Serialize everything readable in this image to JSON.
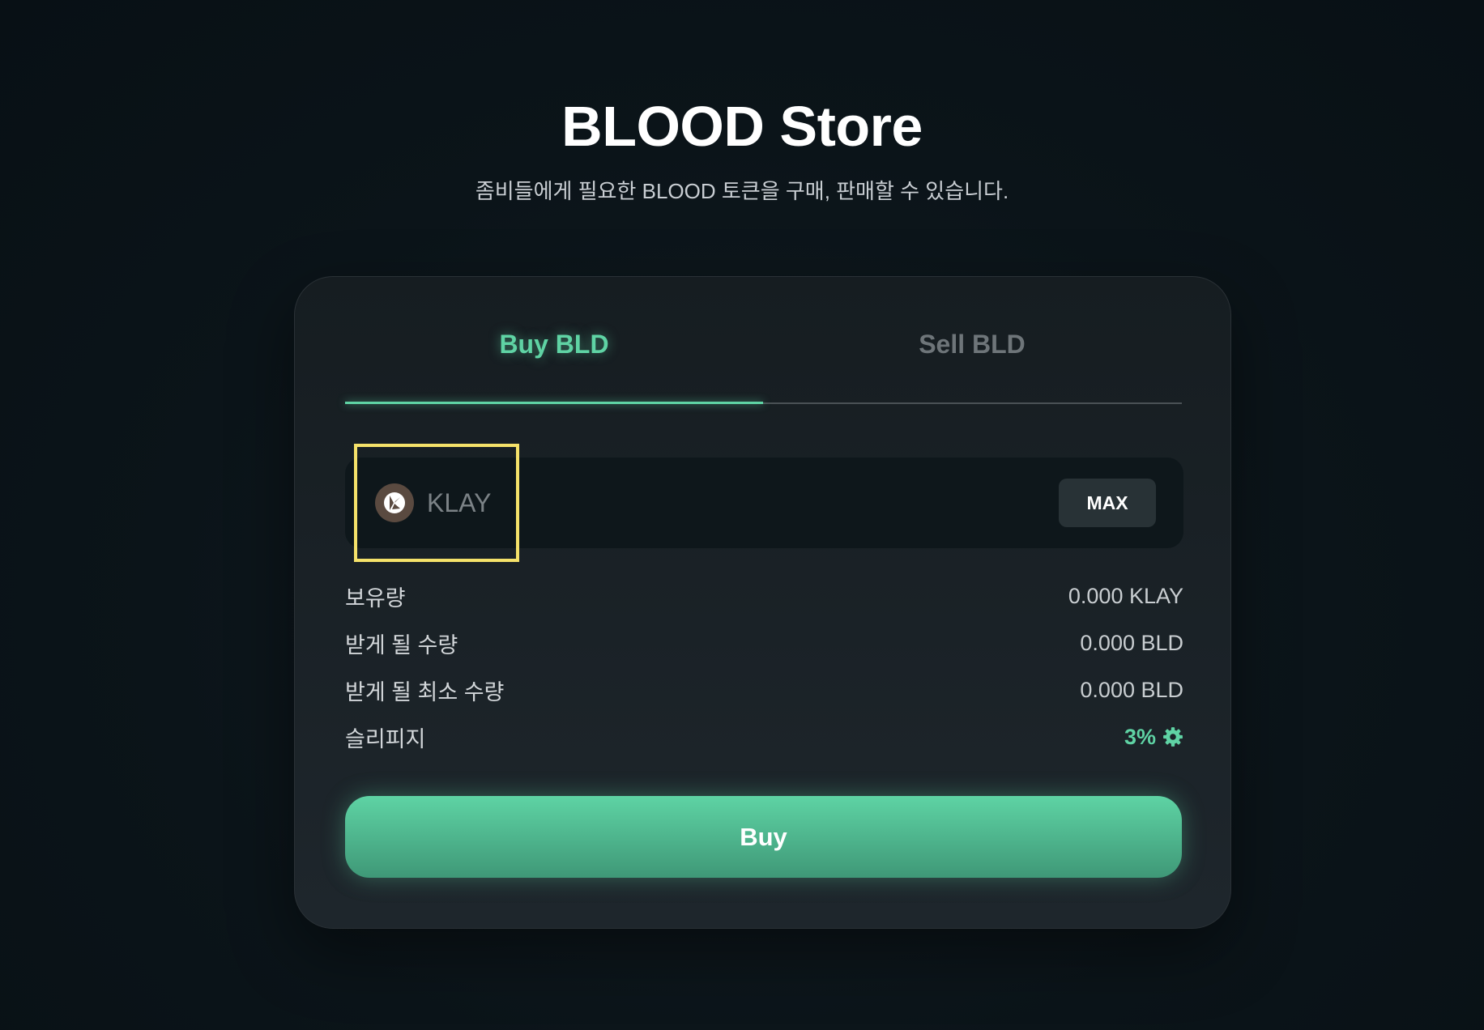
{
  "header": {
    "title": "BLOOD Store",
    "subtitle": "좀비들에게 필요한 BLOOD 토큰을 구매, 판매할 수 있습니다."
  },
  "tabs": {
    "buy_label": "Buy BLD",
    "sell_label": "Sell BLD",
    "active": "buy"
  },
  "input": {
    "token_symbol": "KLAY",
    "token_icon": "klaytn-icon",
    "value": "",
    "max_label": "MAX"
  },
  "info": {
    "balance_label": "보유량",
    "balance_value": "0.000 KLAY",
    "receive_label": "받게 될 수량",
    "receive_value": "0.000 BLD",
    "min_receive_label": "받게 될 최소 수량",
    "min_receive_value": "0.000 BLD",
    "slippage_label": "슬리피지",
    "slippage_value": "3%",
    "slippage_icon": "gear-icon"
  },
  "action": {
    "buy_label": "Buy"
  },
  "colors": {
    "accent": "#5fd3a4",
    "highlight_box": "#f5e26a",
    "background": "#0b1419"
  }
}
